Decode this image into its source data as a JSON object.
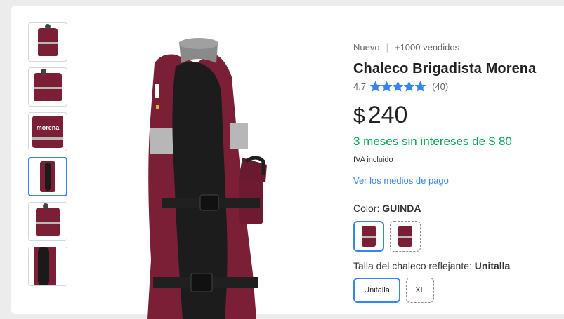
{
  "product": {
    "condition": "Nuevo",
    "sold": "+1000 vendidos",
    "title": "Chaleco Brigadista Morena",
    "rating": "4.7",
    "rating_value": 4.7,
    "reviews": "(40)",
    "currency": "$",
    "price": "240",
    "installments": "3 meses sin intereses de $ 80",
    "tax_note": "IVA incluido",
    "payment_link": "Ver los medios de pago"
  },
  "variants": {
    "color_label": "Color: ",
    "color_value": "GUINDA",
    "size_label": "Talla del chaleco reflejante: ",
    "size_value": "Unitalla",
    "sizes": [
      "Unitalla",
      "XL"
    ]
  },
  "gallery": {
    "thumb_logo": "morena",
    "selected_index": 3
  },
  "colors": {
    "accent": "#3483fa",
    "price_green": "#00a650",
    "vest": "#7b1f36",
    "star": "#3483fa"
  }
}
